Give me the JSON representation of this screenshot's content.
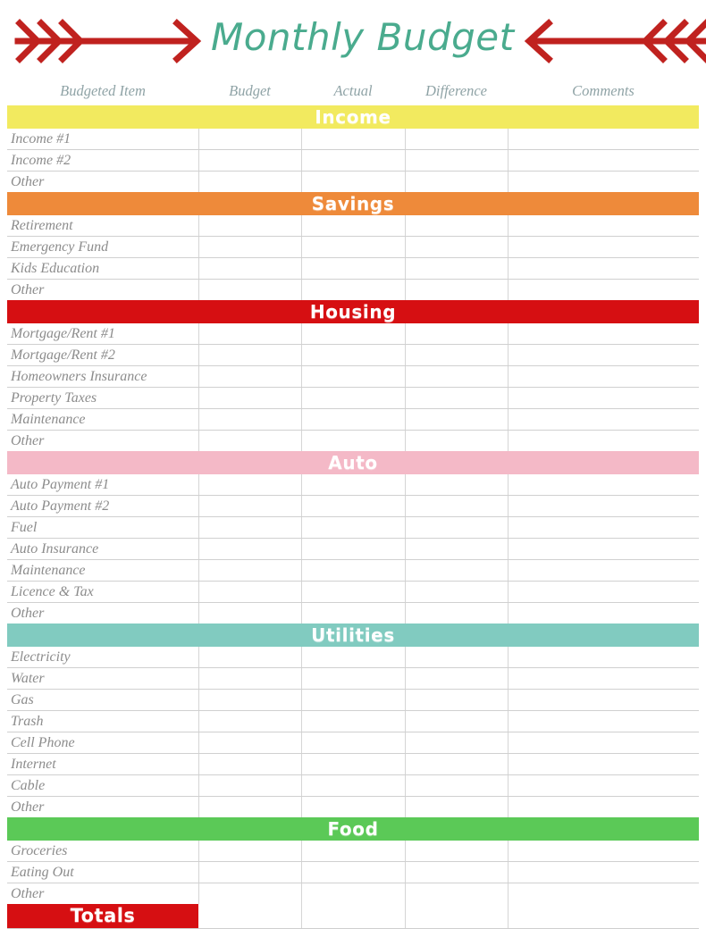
{
  "header": {
    "title": "Monthly Budget",
    "title_color": "#4aab8e",
    "arrow_color": "#c0221f",
    "left_arrow_icon": "arrow-right-feathered-icon",
    "right_arrow_icon": "arrow-left-feathered-icon"
  },
  "table": {
    "columns": [
      {
        "label": "Budgeted Item"
      },
      {
        "label": "Budget"
      },
      {
        "label": "Actual"
      },
      {
        "label": "Difference"
      },
      {
        "label": "Comments"
      }
    ],
    "column_header_color": "#8fa3a6",
    "sections": [
      {
        "name": "Income",
        "color": "#f2ea5f",
        "rows": [
          {
            "label": "Income #1",
            "budget": "",
            "actual": "",
            "difference": "",
            "comments": ""
          },
          {
            "label": "Income #2",
            "budget": "",
            "actual": "",
            "difference": "",
            "comments": ""
          },
          {
            "label": "Other",
            "budget": "",
            "actual": "",
            "difference": "",
            "comments": ""
          }
        ]
      },
      {
        "name": "Savings",
        "color": "#ee8a3a",
        "rows": [
          {
            "label": "Retirement",
            "budget": "",
            "actual": "",
            "difference": "",
            "comments": ""
          },
          {
            "label": "Emergency Fund",
            "budget": "",
            "actual": "",
            "difference": "",
            "comments": ""
          },
          {
            "label": "Kids Education",
            "budget": "",
            "actual": "",
            "difference": "",
            "comments": ""
          },
          {
            "label": "Other",
            "budget": "",
            "actual": "",
            "difference": "",
            "comments": ""
          }
        ]
      },
      {
        "name": "Housing",
        "color": "#d60f12",
        "rows": [
          {
            "label": "Mortgage/Rent #1",
            "budget": "",
            "actual": "",
            "difference": "",
            "comments": ""
          },
          {
            "label": "Mortgage/Rent #2",
            "budget": "",
            "actual": "",
            "difference": "",
            "comments": ""
          },
          {
            "label": "Homeowners Insurance",
            "budget": "",
            "actual": "",
            "difference": "",
            "comments": ""
          },
          {
            "label": "Property Taxes",
            "budget": "",
            "actual": "",
            "difference": "",
            "comments": ""
          },
          {
            "label": "Maintenance",
            "budget": "",
            "actual": "",
            "difference": "",
            "comments": ""
          },
          {
            "label": "Other",
            "budget": "",
            "actual": "",
            "difference": "",
            "comments": ""
          }
        ]
      },
      {
        "name": "Auto",
        "color": "#f4b9c7",
        "rows": [
          {
            "label": "Auto Payment #1",
            "budget": "",
            "actual": "",
            "difference": "",
            "comments": ""
          },
          {
            "label": "Auto Payment #2",
            "budget": "",
            "actual": "",
            "difference": "",
            "comments": ""
          },
          {
            "label": "Fuel",
            "budget": "",
            "actual": "",
            "difference": "",
            "comments": ""
          },
          {
            "label": "Auto Insurance",
            "budget": "",
            "actual": "",
            "difference": "",
            "comments": ""
          },
          {
            "label": "Maintenance",
            "budget": "",
            "actual": "",
            "difference": "",
            "comments": ""
          },
          {
            "label": "Licence & Tax",
            "budget": "",
            "actual": "",
            "difference": "",
            "comments": ""
          },
          {
            "label": "Other",
            "budget": "",
            "actual": "",
            "difference": "",
            "comments": ""
          }
        ]
      },
      {
        "name": "Utilities",
        "color": "#81cbc0",
        "rows": [
          {
            "label": "Electricity",
            "budget": "",
            "actual": "",
            "difference": "",
            "comments": ""
          },
          {
            "label": "Water",
            "budget": "",
            "actual": "",
            "difference": "",
            "comments": ""
          },
          {
            "label": "Gas",
            "budget": "",
            "actual": "",
            "difference": "",
            "comments": ""
          },
          {
            "label": "Trash",
            "budget": "",
            "actual": "",
            "difference": "",
            "comments": ""
          },
          {
            "label": "Cell Phone",
            "budget": "",
            "actual": "",
            "difference": "",
            "comments": ""
          },
          {
            "label": "Internet",
            "budget": "",
            "actual": "",
            "difference": "",
            "comments": ""
          },
          {
            "label": "Cable",
            "budget": "",
            "actual": "",
            "difference": "",
            "comments": ""
          },
          {
            "label": "Other",
            "budget": "",
            "actual": "",
            "difference": "",
            "comments": ""
          }
        ]
      },
      {
        "name": "Food",
        "color": "#5bc957",
        "rows": [
          {
            "label": "Groceries",
            "budget": "",
            "actual": "",
            "difference": "",
            "comments": ""
          },
          {
            "label": "Eating Out",
            "budget": "",
            "actual": "",
            "difference": "",
            "comments": ""
          },
          {
            "label": "Other",
            "budget": "",
            "actual": "",
            "difference": "",
            "comments": ""
          }
        ]
      }
    ],
    "totals": {
      "label": "Totals",
      "color": "#d60f12",
      "budget": "",
      "actual": "",
      "difference": "",
      "comments": ""
    }
  }
}
